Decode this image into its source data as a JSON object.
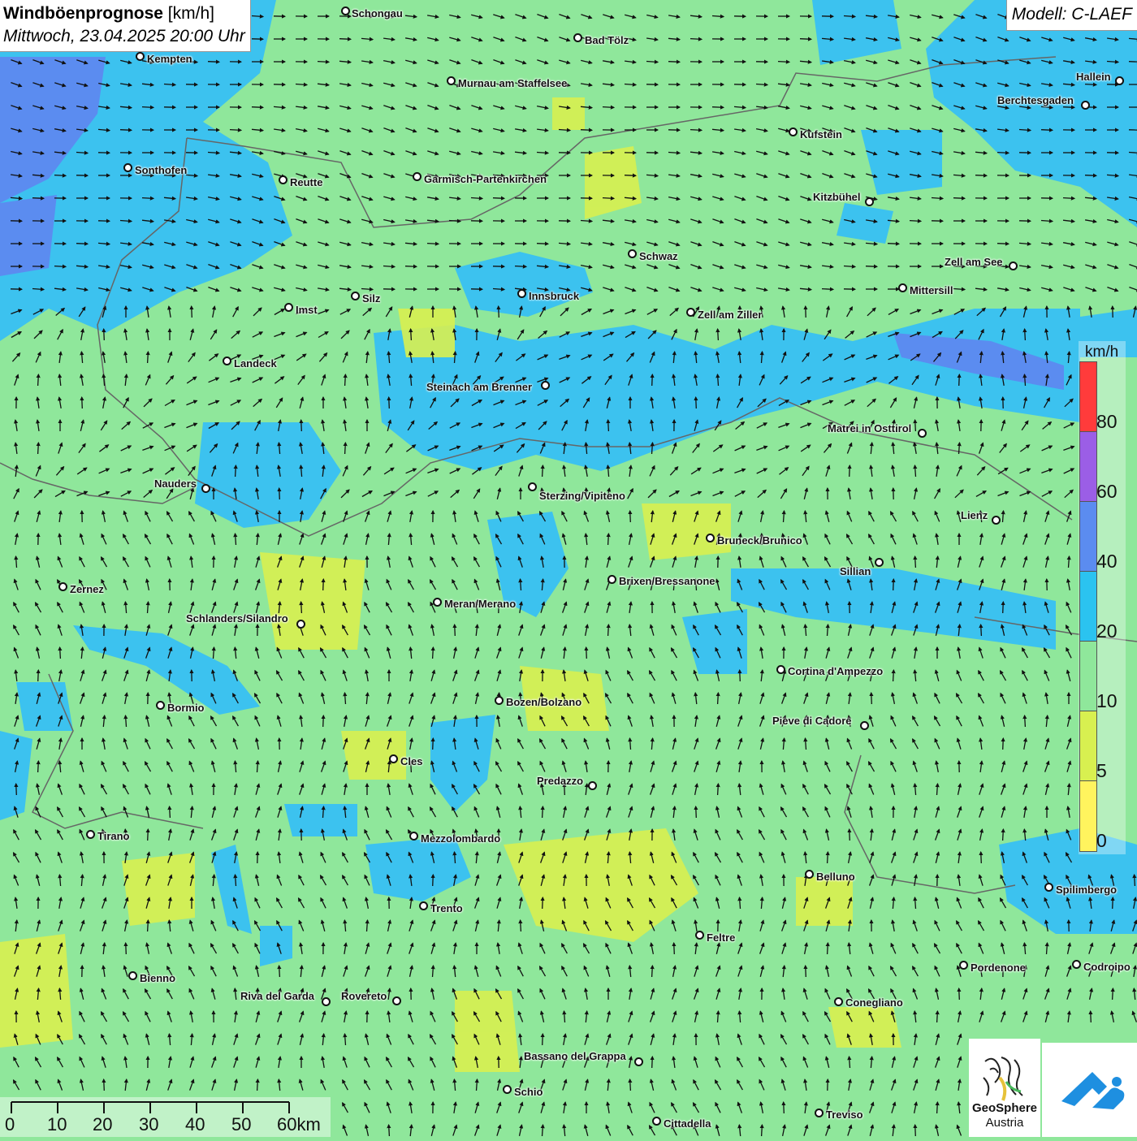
{
  "title": {
    "bold": "Windböenprognose",
    "unit": " [km/h]",
    "subtitle": "Mittwoch, 23.04.2025 20:00 Uhr"
  },
  "model": "Modell: C-LAEF",
  "legend": {
    "unit": "km/h",
    "ticks": [
      "80",
      "60",
      "40",
      "20",
      "10",
      "5",
      "0"
    ],
    "colors": [
      "#ff3b3b",
      "#9b5ee6",
      "#5b8cf0",
      "#2bc3f0",
      "#8fe79b",
      "#d8f050",
      "#fff45e"
    ]
  },
  "scalebar": {
    "labels": [
      "0",
      "10",
      "20",
      "30",
      "40",
      "50",
      "60km"
    ]
  },
  "logos": {
    "geosphere_line1": "GeoSphere",
    "geosphere_line2": "Austria"
  },
  "cities": [
    {
      "name": "Schongau"
    },
    {
      "name": "Bad Tölz"
    },
    {
      "name": "Kempten"
    },
    {
      "name": "Murnau am Staffelsee"
    },
    {
      "name": "Hallein"
    },
    {
      "name": "Berchtesgaden"
    },
    {
      "name": "Kufstein"
    },
    {
      "name": "Sonthofen"
    },
    {
      "name": "Reutte"
    },
    {
      "name": "Garmisch-Partenkirchen"
    },
    {
      "name": "Kitzbühel"
    },
    {
      "name": "Schwaz"
    },
    {
      "name": "Zell am See"
    },
    {
      "name": "Innsbruck"
    },
    {
      "name": "Mittersill"
    },
    {
      "name": "Silz"
    },
    {
      "name": "Imst"
    },
    {
      "name": "Zell am Ziller"
    },
    {
      "name": "Landeck"
    },
    {
      "name": "Steinach am Brenner"
    },
    {
      "name": "Matrei in Osttirol"
    },
    {
      "name": "Nauders"
    },
    {
      "name": "Sterzing/Vipiteno"
    },
    {
      "name": "Lienz"
    },
    {
      "name": "Bruneck/Brunico"
    },
    {
      "name": "Sillian"
    },
    {
      "name": "Brixen/Bressanone"
    },
    {
      "name": "Zernez"
    },
    {
      "name": "Meran/Merano"
    },
    {
      "name": "Schlanders/Silandro"
    },
    {
      "name": "Cortina d'Ampezzo"
    },
    {
      "name": "Bozen/Bolzano"
    },
    {
      "name": "Bormio"
    },
    {
      "name": "Pieve di Cadore"
    },
    {
      "name": "Cles"
    },
    {
      "name": "Predazzo"
    },
    {
      "name": "Tirano"
    },
    {
      "name": "Mezzolombardo"
    },
    {
      "name": "Belluno"
    },
    {
      "name": "Spilimbergo"
    },
    {
      "name": "Trento"
    },
    {
      "name": "Feltre"
    },
    {
      "name": "Bienno"
    },
    {
      "name": "Pordenone"
    },
    {
      "name": "Codroipo"
    },
    {
      "name": "Riva del Garda"
    },
    {
      "name": "Rovereto"
    },
    {
      "name": "Conegliano"
    },
    {
      "name": "Bassano del Grappa"
    },
    {
      "name": "Schio"
    },
    {
      "name": "Treviso"
    },
    {
      "name": "Cittadella"
    }
  ]
}
